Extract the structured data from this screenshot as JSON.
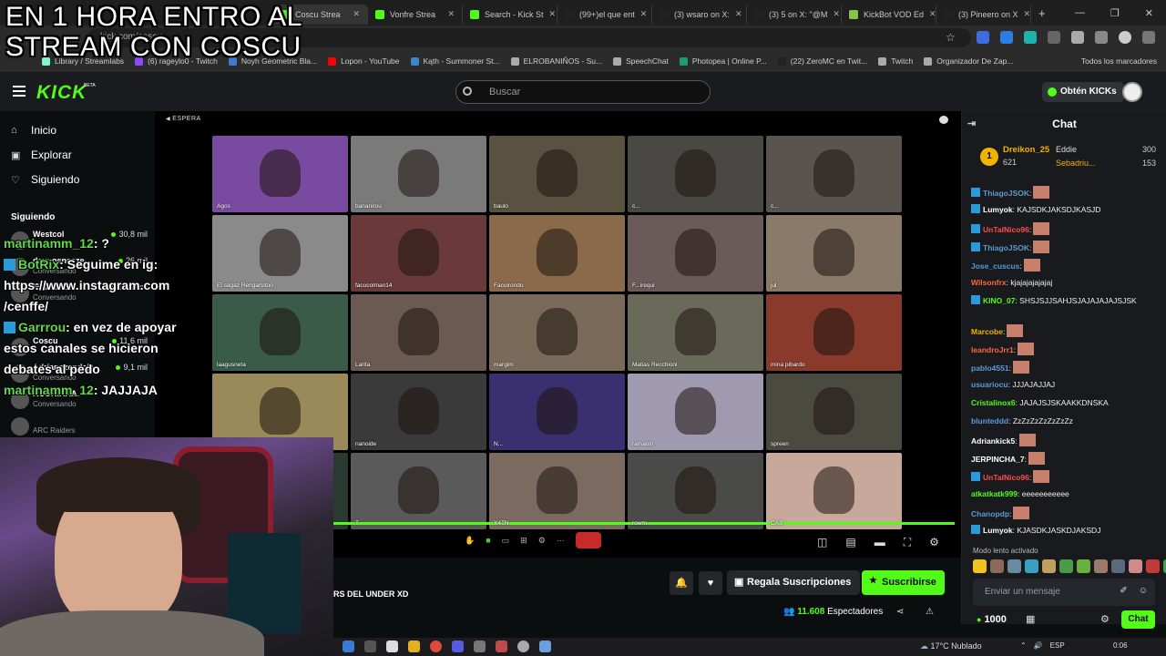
{
  "overlay_text": "EN 1 HORA ENTRO AL\nSTREAM CON COSCU",
  "browser": {
    "tabs": [
      {
        "label": "Coscu Strea",
        "color": "#53fc18",
        "active": true
      },
      {
        "label": "Vonfre Strea",
        "color": "#53fc18",
        "active": false
      },
      {
        "label": "Search - Kick St",
        "color": "#53fc18",
        "active": false
      },
      {
        "label": "(99+)el que ent",
        "color": "#222222",
        "active": false
      },
      {
        "label": "(3) wsaro on X:",
        "color": "#222222",
        "active": false
      },
      {
        "label": "(3) 5 on X: \"@M",
        "color": "#222222",
        "active": false
      },
      {
        "label": "KickBot VOD Ed",
        "color": "#8bc34a",
        "active": false
      },
      {
        "label": "(3) Pineero on X",
        "color": "#222222",
        "active": false
      }
    ],
    "url": "kick.com/coscu",
    "bookmarks": [
      {
        "label": "Library / Streamlabs",
        "color": "#80f7c7"
      },
      {
        "label": "(6) rageylo0 - Twitch",
        "color": "#9147ff"
      },
      {
        "label": "Noyh Geometric Bla...",
        "color": "#3d7bd6"
      },
      {
        "label": "Lopon - YouTube",
        "color": "#ff0000"
      },
      {
        "label": "Kąth - Summoner St...",
        "color": "#3a86c8"
      },
      {
        "label": "ELROBANIÑOS - Su...",
        "color": "#aaaaaa"
      },
      {
        "label": "SpeechChat",
        "color": "#aaaaaa"
      },
      {
        "label": "Photopea | Online P...",
        "color": "#1a9e6a"
      },
      {
        "label": "(22) ZeroMC en Twit...",
        "color": "#222222"
      },
      {
        "label": "Twitch",
        "color": "#aaaaaa"
      },
      {
        "label": "Organizador De Zap...",
        "color": "#aaaaaa"
      }
    ],
    "all_bookmarks": "Todos los marcadores"
  },
  "kick": {
    "logo": "KICK",
    "beta": "BETA",
    "search_placeholder": "Buscar",
    "kicks_button": "Obtén KICKs"
  },
  "sidebar": {
    "nav": [
      {
        "label": "Inicio",
        "icon": "home-icon",
        "glyph": "⌂"
      },
      {
        "label": "Explorar",
        "icon": "compass-icon",
        "glyph": "▣"
      },
      {
        "label": "Siguiendo",
        "icon": "heart-icon",
        "glyph": "♡"
      }
    ],
    "following_title": "Siguiendo",
    "channels": [
      {
        "name": "Westcol",
        "sub": "",
        "viewers": "30,8 mil"
      },
      {
        "name": "davoosneeze",
        "sub": "Conversando",
        "viewers": "26 mil"
      },
      {
        "name": "MERNUEL",
        "sub": "Conversando",
        "viewers": "17,2 mil"
      },
      {
        "name": "Coscu",
        "sub": "",
        "viewers": "11,6 mil"
      },
      {
        "name": "Adrianozendeja...",
        "sub": "Conversando",
        "viewers": "9,1 mil"
      },
      {
        "name": "ACORIAAA",
        "sub": "Conversando",
        "viewers": ""
      },
      {
        "name": "",
        "sub": "ARC Raiders",
        "viewers": ""
      }
    ]
  },
  "overlay_chat": [
    {
      "user": "martinamm_12",
      "text": " ?",
      "badge": false
    },
    {
      "user": "BotRix",
      "text": " Seguime en ig: https://www.instagram.com /cenffe/",
      "badge": true
    },
    {
      "user": "Garrrou",
      "text": " en vez de apoyar estos canales se hicieron debates al pedo",
      "badge": true
    },
    {
      "user": "martinamm_12",
      "text": " JAJJAJA",
      "badge": false
    }
  ],
  "player": {
    "status": "ESPERA",
    "tiles": [
      {
        "name": "Agos",
        "bg": "#7a4aa0"
      },
      {
        "name": "bananirou",
        "bg": "#7a7a7a"
      },
      {
        "name": "baulo",
        "bg": "#5a5240"
      },
      {
        "name": "c...",
        "bg": "#4a4844"
      },
      {
        "name": "c...",
        "bg": "#5a5450"
      },
      {
        "name": "El sagaz Rengarsitoo",
        "bg": "#8a8a8a"
      },
      {
        "name": "facucolman14",
        "bg": "#6a3a3a"
      },
      {
        "name": "Facuirondo",
        "bg": "#8a6a4a"
      },
      {
        "name": "F...irequi",
        "bg": "#6a5a5a"
      },
      {
        "name": "jul",
        "bg": "#8a7a6a"
      },
      {
        "name": "laagusneta",
        "bg": "#3a5a4a"
      },
      {
        "name": "Larita",
        "bg": "#6a5a52"
      },
      {
        "name": "margim",
        "bg": "#7a6a5a"
      },
      {
        "name": "Matias Recchioni",
        "bg": "#6a6a5a"
      },
      {
        "name": "mina pibardo",
        "bg": "#8a3a2a"
      },
      {
        "name": "",
        "bg": "#9a8a5a"
      },
      {
        "name": "nanoide",
        "bg": "#3a3a3a"
      },
      {
        "name": "N...",
        "bg": "#3a3070"
      },
      {
        "name": "ramanin",
        "bg": "#a09ab0"
      },
      {
        "name": "spreen",
        "bg": "#4a4a40"
      },
      {
        "name": "",
        "bg": "#2a3a30"
      },
      {
        "name": "T",
        "bg": "#5a5a5a"
      },
      {
        "name": "X4TN",
        "bg": "#7a6a60"
      },
      {
        "name": "rowm",
        "bg": "#4a4a48"
      },
      {
        "name": "CAS",
        "bg": "#c8a89a"
      }
    ]
  },
  "below_player": {
    "stream_title": "RS DEL UNDER XD",
    "gift_button": "Regala Suscripciones",
    "subscribe_button": "Suscribirse",
    "viewers_count": "11.608",
    "viewers_label": "Espectadores"
  },
  "chat": {
    "title": "Chat",
    "leaderboard": {
      "top_rank": "1",
      "top_name": "Dreikon_25",
      "top_value": "621",
      "rows": [
        {
          "name": "Eddie",
          "value": "300"
        },
        {
          "name": "Sebadriu...",
          "value": "153"
        }
      ]
    },
    "messages": [
      {
        "user": "ThiagoJSOK",
        "text": "",
        "color": "#5b9bd5",
        "badge": true,
        "emote": true
      },
      {
        "user": "Lumyok",
        "text": " KAJSDKJAKSDJKASJD",
        "color": "#ffffff",
        "badge": true,
        "emote": false
      },
      {
        "user": "UnTalNico96",
        "text": "",
        "color": "#ff4d4d",
        "badge": true,
        "emote": true
      },
      {
        "user": "ThiagoJSOK",
        "text": "",
        "color": "#5b9bd5",
        "badge": true,
        "emote": true
      },
      {
        "user": "Jose_cuscus",
        "text": "",
        "color": "#5b9bd5",
        "badge": false,
        "emote": true
      },
      {
        "user": "Wilsonfrx",
        "text": " kjajajajajajaj",
        "color": "#ff6a3d",
        "badge": false,
        "emote": false
      },
      {
        "user": "KINO_07",
        "text": " SHSJSJJSAHJSJAJAJAJAJSJSK",
        "color": "#53fc18",
        "badge": true,
        "emote": false
      },
      {
        "user": "Marcobe",
        "text": "",
        "color": "#f0b400",
        "badge": false,
        "emote": true
      },
      {
        "user": "leandroJrr1",
        "text": "",
        "color": "#ff6a3d",
        "badge": false,
        "emote": true
      },
      {
        "user": "pablo4551",
        "text": "",
        "color": "#5b9bd5",
        "badge": false,
        "emote": true
      },
      {
        "user": "usuariocu",
        "text": " JJJAJAJJAJ",
        "color": "#5b9bd5",
        "badge": false,
        "emote": false
      },
      {
        "user": "Cristalinox6",
        "text": " JAJAJSJSKAAKKDNSKA",
        "color": "#53fc18",
        "badge": false,
        "emote": false
      },
      {
        "user": "blunteddd",
        "text": " ZzZzZzZzZzZzZz",
        "color": "#5b9bd5",
        "badge": false,
        "emote": false
      },
      {
        "user": "Adriankick5",
        "text": "",
        "color": "#ffffff",
        "badge": false,
        "emote": true
      },
      {
        "user": "JERPINCHA_7",
        "text": "",
        "color": "#ffffff",
        "badge": false,
        "emote": true
      },
      {
        "user": "UnTalNico96",
        "text": "",
        "color": "#ff4d4d",
        "badge": true,
        "emote": true
      },
      {
        "user": "atkatkatk999",
        "text": " eeeeeeeeeee",
        "color": "#53fc18",
        "badge": false,
        "emote": false
      },
      {
        "user": "Chanopdp",
        "text": "",
        "color": "#5b9bd5",
        "badge": false,
        "emote": true
      },
      {
        "user": "Lumyok",
        "text": " KJASDKJASKDJAKSDJ",
        "color": "#ffffff",
        "badge": true,
        "emote": false
      }
    ],
    "slow_mode": "Modo lento activado",
    "input_placeholder": "Enviar un mensaje",
    "points": "1000",
    "chat_button": "Chat"
  },
  "taskbar": {
    "weather": "17°C  Nublado",
    "lang": "ESP",
    "time": "0:06"
  }
}
